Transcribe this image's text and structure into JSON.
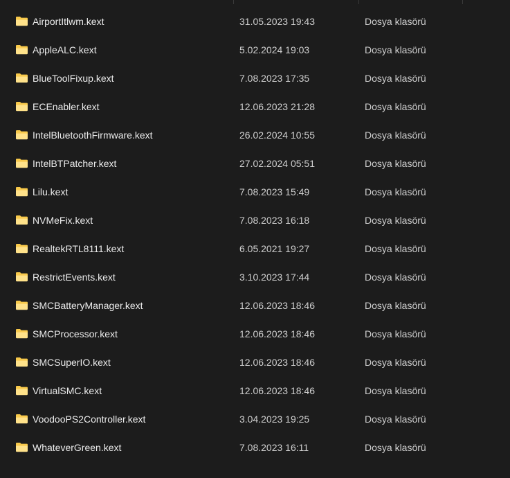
{
  "colors": {
    "background": "#1c1c1c",
    "folder_yellow": "#f8c94a",
    "folder_light": "#ffe28a",
    "text": "#ececec"
  },
  "files": [
    {
      "name": "AirportItlwm.kext",
      "date": "31.05.2023 19:43",
      "type": "Dosya klasörü",
      "icon": "folder-icon"
    },
    {
      "name": "AppleALC.kext",
      "date": "5.02.2024 19:03",
      "type": "Dosya klasörü",
      "icon": "folder-icon"
    },
    {
      "name": "BlueToolFixup.kext",
      "date": "7.08.2023 17:35",
      "type": "Dosya klasörü",
      "icon": "folder-icon"
    },
    {
      "name": "ECEnabler.kext",
      "date": "12.06.2023 21:28",
      "type": "Dosya klasörü",
      "icon": "folder-icon"
    },
    {
      "name": "IntelBluetoothFirmware.kext",
      "date": "26.02.2024 10:55",
      "type": "Dosya klasörü",
      "icon": "folder-icon"
    },
    {
      "name": "IntelBTPatcher.kext",
      "date": "27.02.2024 05:51",
      "type": "Dosya klasörü",
      "icon": "folder-icon"
    },
    {
      "name": "Lilu.kext",
      "date": "7.08.2023 15:49",
      "type": "Dosya klasörü",
      "icon": "folder-icon"
    },
    {
      "name": "NVMeFix.kext",
      "date": "7.08.2023 16:18",
      "type": "Dosya klasörü",
      "icon": "folder-icon"
    },
    {
      "name": "RealtekRTL8111.kext",
      "date": "6.05.2021 19:27",
      "type": "Dosya klasörü",
      "icon": "folder-icon"
    },
    {
      "name": "RestrictEvents.kext",
      "date": "3.10.2023 17:44",
      "type": "Dosya klasörü",
      "icon": "folder-icon"
    },
    {
      "name": "SMCBatteryManager.kext",
      "date": "12.06.2023 18:46",
      "type": "Dosya klasörü",
      "icon": "folder-icon"
    },
    {
      "name": "SMCProcessor.kext",
      "date": "12.06.2023 18:46",
      "type": "Dosya klasörü",
      "icon": "folder-icon"
    },
    {
      "name": "SMCSuperIO.kext",
      "date": "12.06.2023 18:46",
      "type": "Dosya klasörü",
      "icon": "folder-icon"
    },
    {
      "name": "VirtualSMC.kext",
      "date": "12.06.2023 18:46",
      "type": "Dosya klasörü",
      "icon": "folder-icon"
    },
    {
      "name": "VoodooPS2Controller.kext",
      "date": "3.04.2023 19:25",
      "type": "Dosya klasörü",
      "icon": "folder-icon"
    },
    {
      "name": "WhateverGreen.kext",
      "date": "7.08.2023 16:11",
      "type": "Dosya klasörü",
      "icon": "folder-icon"
    }
  ]
}
